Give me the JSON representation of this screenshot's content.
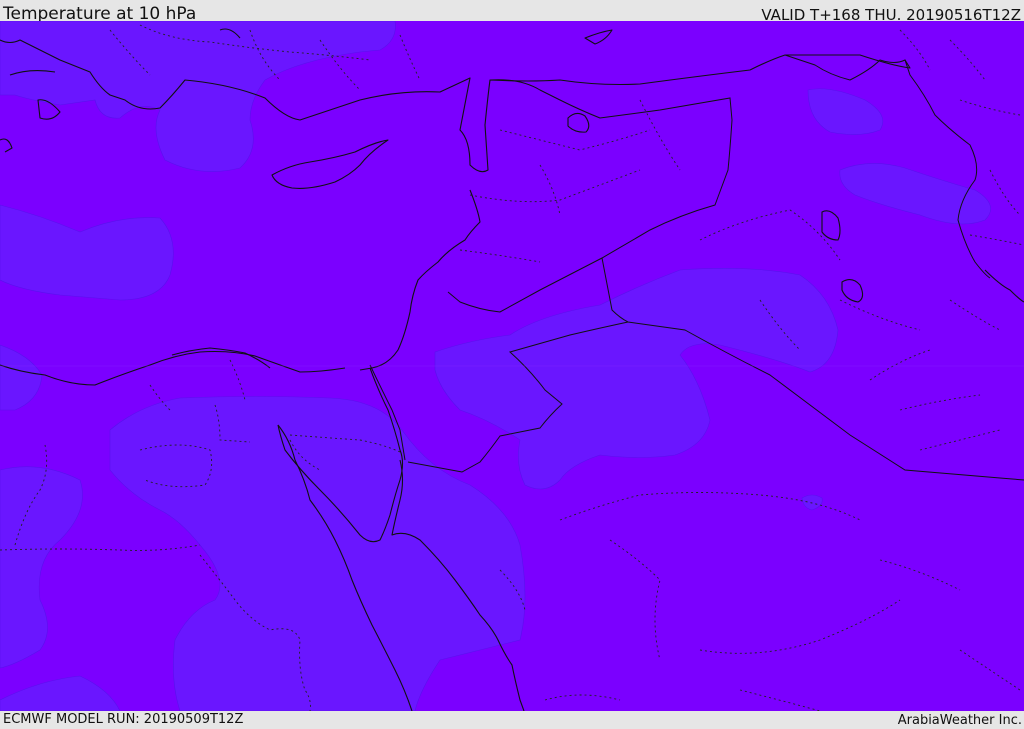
{
  "header": {
    "title": "Temperature at 10 hPa",
    "valid": "VALID T+168 THU. 20190516T12Z"
  },
  "footer": {
    "model_run": "ECMWF MODEL RUN: 20190509T12Z",
    "brand": "ArabiaWeather Inc."
  },
  "map": {
    "colors": {
      "background": "#7b00ff",
      "field_cooler": "#6a16ff",
      "coastline": "#111111",
      "border_dotted": "#222222"
    }
  }
}
